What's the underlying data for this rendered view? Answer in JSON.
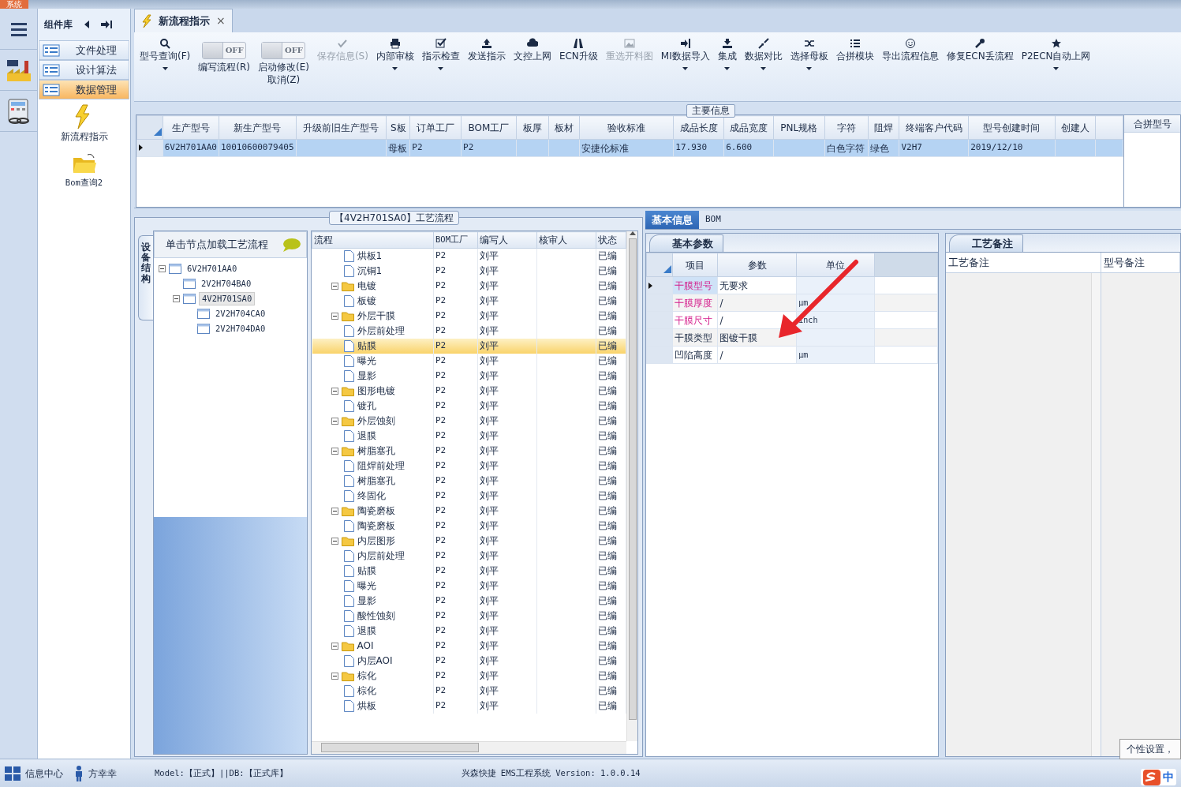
{
  "system_tab": "系统",
  "sidebar": {
    "title": "组件库",
    "groups": [
      {
        "label": "文件处理",
        "selected": false
      },
      {
        "label": "设计算法",
        "selected": false
      },
      {
        "label": "数据管理",
        "selected": true
      }
    ],
    "tools": [
      {
        "label": "新流程指示",
        "kind": "bolt"
      },
      {
        "label": "Bom查询2",
        "kind": "folder"
      }
    ]
  },
  "doc_tab": {
    "title": "新流程指示",
    "close": "×",
    "selected": true
  },
  "toolbar": [
    {
      "kind": "search",
      "label": "型号查询(F)",
      "dropdown": true,
      "disabled": false
    },
    {
      "kind": "toggle",
      "toggle_text": "OFF",
      "label": "编写流程(R)",
      "on": false
    },
    {
      "kind": "toggle",
      "toggle_text": "OFF",
      "label": "启动修改(E)",
      "sublabel": "取消(Z)",
      "on": false
    },
    {
      "kind": "check",
      "label": "保存信息(S)",
      "dropdown": false,
      "disabled": true
    },
    {
      "kind": "printer",
      "label": "内部审核",
      "dropdown": true,
      "disabled": false
    },
    {
      "kind": "checkbox",
      "label": "指示检查",
      "dropdown": true,
      "disabled": false
    },
    {
      "kind": "upload",
      "label": "发送指示",
      "dropdown": false,
      "disabled": false
    },
    {
      "kind": "cloud",
      "label": "文控上网",
      "dropdown": false,
      "disabled": false
    },
    {
      "kind": "road",
      "label": "ECN升级",
      "dropdown": false,
      "disabled": false
    },
    {
      "kind": "image",
      "label": "重选开料图",
      "dropdown": false,
      "disabled": true
    },
    {
      "kind": "import",
      "label": "MI数据导入",
      "dropdown": true,
      "disabled": false
    },
    {
      "kind": "download",
      "label": "集成",
      "dropdown": true,
      "disabled": false
    },
    {
      "kind": "compress",
      "label": "数据对比",
      "dropdown": true,
      "disabled": false
    },
    {
      "kind": "shuffle",
      "label": "选择母板",
      "dropdown": true,
      "disabled": false
    },
    {
      "kind": "list",
      "label": "合拼模块",
      "dropdown": false,
      "disabled": false
    },
    {
      "kind": "smiley",
      "label": "导出流程信息",
      "dropdown": false,
      "disabled": false
    },
    {
      "kind": "wrench",
      "label": "修复ECN丢流程",
      "dropdown": false,
      "disabled": false
    },
    {
      "kind": "star",
      "label": "P2ECN自动上网",
      "dropdown": true,
      "disabled": false
    }
  ],
  "main_info": {
    "title": "主要信息",
    "columns": [
      "生产型号",
      "新生产型号",
      "升级前旧生产型号",
      "S板",
      "订单工厂",
      "BOM工厂",
      "板厚",
      "板材",
      "验收标准",
      "成品长度",
      "成品宽度",
      "PNL规格",
      "字符",
      "阻焊",
      "终端客户代码",
      "型号创建时间",
      "创建人"
    ],
    "rows": [
      {
        "selected": true,
        "cells": [
          "6V2H701AA0",
          "10010600079405",
          null,
          "母板",
          "P2",
          "P2",
          null,
          null,
          "安捷伦标准",
          "17.930",
          "6.600",
          null,
          "白色字符",
          "绿色",
          "V2H7",
          "2019/12/10",
          null
        ]
      }
    ],
    "side_column": "合拼型号"
  },
  "process": {
    "title": "【4V2H701SA0】工艺流程",
    "side_tab": "设备结构",
    "tree_header": "单击节点加载工艺流程",
    "tree": [
      {
        "label": "6V2H701AA0",
        "expanded": true,
        "selected": false,
        "children": [
          {
            "label": "2V2H704BA0",
            "selected": false
          },
          {
            "label": "4V2H701SA0",
            "expanded": true,
            "selected": true,
            "children": [
              {
                "label": "2V2H704CA0",
                "selected": false
              },
              {
                "label": "2V2H704DA0",
                "selected": false
              }
            ]
          }
        ]
      }
    ],
    "columns": [
      "流程",
      "BOM工厂",
      "编写人",
      "核审人",
      "状态"
    ],
    "steps": [
      {
        "children": [
          {
            "name": "烘板1",
            "bom": "P2",
            "writer": "刘平",
            "status": "已编",
            "selected": false
          },
          {
            "name": "沉铜1",
            "bom": "P2",
            "writer": "刘平",
            "status": "已编",
            "selected": false
          }
        ]
      },
      {
        "name": "电镀",
        "bom": "P2",
        "writer": "刘平",
        "status": "已编",
        "expanded": true,
        "children": [
          {
            "name": "板镀",
            "bom": "P2",
            "writer": "刘平",
            "status": "已编",
            "selected": false
          }
        ]
      },
      {
        "name": "外层干膜",
        "bom": "P2",
        "writer": "刘平",
        "status": "已编",
        "expanded": true,
        "children": [
          {
            "name": "外层前处理",
            "bom": "P2",
            "writer": "刘平",
            "status": "已编",
            "selected": false
          },
          {
            "name": "贴膜",
            "bom": "P2",
            "writer": "刘平",
            "status": "已编",
            "selected": true
          },
          {
            "name": "曝光",
            "bom": "P2",
            "writer": "刘平",
            "status": "已编",
            "selected": false
          },
          {
            "name": "显影",
            "bom": "P2",
            "writer": "刘平",
            "status": "已编",
            "selected": false
          }
        ]
      },
      {
        "name": "图形电镀",
        "bom": "P2",
        "writer": "刘平",
        "status": "已编",
        "expanded": true,
        "children": [
          {
            "name": "镀孔",
            "bom": "P2",
            "writer": "刘平",
            "status": "已编",
            "selected": false
          }
        ]
      },
      {
        "name": "外层蚀刻",
        "bom": "P2",
        "writer": "刘平",
        "status": "已编",
        "expanded": true,
        "children": [
          {
            "name": "退膜",
            "bom": "P2",
            "writer": "刘平",
            "status": "已编",
            "selected": false
          }
        ]
      },
      {
        "name": "树脂塞孔",
        "bom": "P2",
        "writer": "刘平",
        "status": "已编",
        "expanded": true,
        "children": [
          {
            "name": "阻焊前处理",
            "bom": "P2",
            "writer": "刘平",
            "status": "已编",
            "selected": false
          },
          {
            "name": "树脂塞孔",
            "bom": "P2",
            "writer": "刘平",
            "status": "已编",
            "selected": false
          },
          {
            "name": "终固化",
            "bom": "P2",
            "writer": "刘平",
            "status": "已编",
            "selected": false
          }
        ]
      },
      {
        "name": "陶瓷磨板",
        "bom": "P2",
        "writer": "刘平",
        "status": "已编",
        "expanded": true,
        "children": [
          {
            "name": "陶瓷磨板",
            "bom": "P2",
            "writer": "刘平",
            "status": "已编",
            "selected": false
          }
        ]
      },
      {
        "name": "内层图形",
        "bom": "P2",
        "writer": "刘平",
        "status": "已编",
        "expanded": true,
        "children": [
          {
            "name": "内层前处理",
            "bom": "P2",
            "writer": "刘平",
            "status": "已编",
            "selected": false
          },
          {
            "name": "贴膜",
            "bom": "P2",
            "writer": "刘平",
            "status": "已编",
            "selected": false
          },
          {
            "name": "曝光",
            "bom": "P2",
            "writer": "刘平",
            "status": "已编",
            "selected": false
          },
          {
            "name": "显影",
            "bom": "P2",
            "writer": "刘平",
            "status": "已编",
            "selected": false
          },
          {
            "name": "酸性蚀刻",
            "bom": "P2",
            "writer": "刘平",
            "status": "已编",
            "selected": false
          },
          {
            "name": "退膜",
            "bom": "P2",
            "writer": "刘平",
            "status": "已编",
            "selected": false
          }
        ]
      },
      {
        "name": "AOI",
        "bom": "P2",
        "writer": "刘平",
        "status": "已编",
        "expanded": true,
        "children": [
          {
            "name": "内层AOI",
            "bom": "P2",
            "writer": "刘平",
            "status": "已编",
            "selected": false
          }
        ]
      },
      {
        "name": "棕化",
        "bom": "P2",
        "writer": "刘平",
        "status": "已编",
        "expanded": true,
        "children": [
          {
            "name": "棕化",
            "bom": "P2",
            "writer": "刘平",
            "status": "已编",
            "selected": false
          },
          {
            "name": "烘板",
            "bom": "P2",
            "writer": "刘平",
            "status": "已编",
            "selected": false
          }
        ]
      }
    ]
  },
  "detail_tabs": [
    {
      "label": "基本信息",
      "selected": true
    },
    {
      "label": "BOM",
      "selected": false
    }
  ],
  "params": {
    "tab": "基本参数",
    "columns": [
      "项目",
      "参数",
      "单位"
    ],
    "rows": [
      {
        "item": "干膜型号",
        "value": "无要求",
        "required": true,
        "current": true
      },
      {
        "item": "干膜厚度",
        "value": "/",
        "unit": "μm",
        "required": true,
        "current": false
      },
      {
        "item": "干膜尺寸",
        "value": "/",
        "unit": "inch",
        "required": true,
        "current": false
      },
      {
        "item": "干膜类型",
        "value": "图镀干膜",
        "required": false,
        "current": false
      },
      {
        "item": "凹陷高度",
        "value": "/",
        "unit": "μm",
        "required": false,
        "current": false
      }
    ]
  },
  "notes": {
    "tab": "工艺备注",
    "columns": [
      "工艺备注",
      "型号备注"
    ]
  },
  "status_bar": {
    "info": "信息中心",
    "user": "方幸幸",
    "model": "Model:【正式】||DB:【正式库】",
    "version": "兴森快捷 EMS工程系统 Version: 1.0.0.14",
    "tooltip": "个性设置，",
    "ime": "中"
  }
}
